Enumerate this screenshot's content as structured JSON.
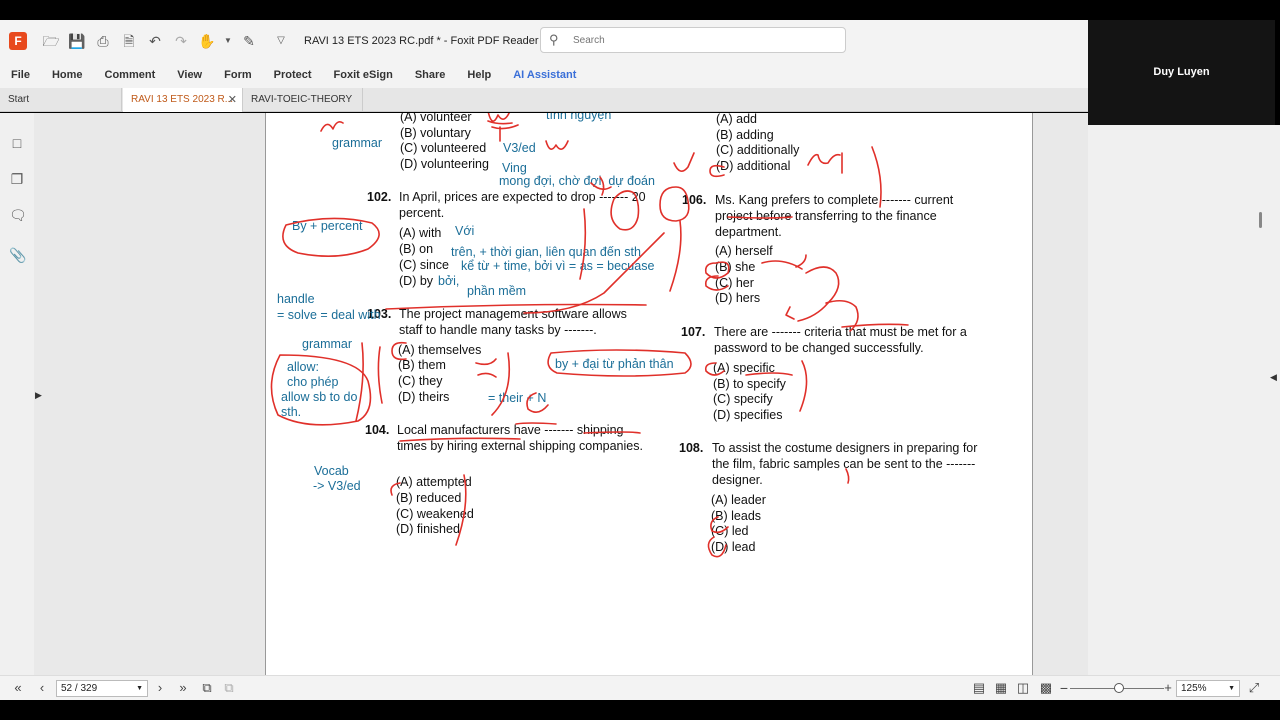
{
  "window": {
    "title": "RAVI 13 ETS 2023 RC.pdf * - Foxit PDF Reader",
    "search_placeholder": "Search"
  },
  "menu": [
    "File",
    "Home",
    "Comment",
    "View",
    "Form",
    "Protect",
    "Foxit eSign",
    "Share",
    "Help",
    "AI Assistant"
  ],
  "tabs": [
    {
      "label": "Start"
    },
    {
      "label": "RAVI 13 ETS 2023 R..."
    },
    {
      "label": "RAVI-TOEIC-THEORY"
    }
  ],
  "camera": {
    "name": "Duy Luyen"
  },
  "page": {
    "q101_options": [
      "(A)  volunteer",
      "(B)  voluntary",
      "(C)  volunteered",
      "(D)  volunteering"
    ],
    "q102": {
      "num": "102.",
      "text": "In April, prices are expected to drop ------- 20 percent.",
      "options": [
        "(A)  with",
        "(B)  on",
        "(C)  since",
        "(D)  by"
      ]
    },
    "q103": {
      "num": "103.",
      "text": "The project management software allows staff to handle many tasks by -------.",
      "options": [
        "(A)  themselves",
        "(B)  them",
        "(C)  they",
        "(D)  theirs"
      ]
    },
    "q104": {
      "num": "104.",
      "text": "Local manufacturers have ------- shipping times by hiring external shipping companies.",
      "options": [
        "(A)  attempted",
        "(B)  reduced",
        "(C)  weakened",
        "(D)  finished"
      ]
    },
    "q105_options": [
      "(A)  add",
      "(B)  adding",
      "(C)  additionally",
      "(D)  additional"
    ],
    "q106": {
      "num": "106.",
      "text": "Ms. Kang prefers to complete ------- current project before transferring to the finance department.",
      "options": [
        "(A)  herself",
        "(B)  she",
        "(C)  her",
        "(D)  hers"
      ]
    },
    "q107": {
      "num": "107.",
      "text": "There are ------- criteria that must be met for a password to be changed successfully.",
      "options": [
        "(A)  specific",
        "(B)  to specify",
        "(C)  specify",
        "(D)  specifies"
      ]
    },
    "q108": {
      "num": "108.",
      "text": "To assist the costume designers in preparing for the film, fabric samples can be sent to the ------- designer.",
      "options": [
        "(A)  leader",
        "(B)  leads",
        "(C)  led",
        "(D)  lead"
      ]
    }
  },
  "notes": {
    "tinh_nguyen": "tình nguyện",
    "grammar1": "grammar",
    "v3ed": "V3/ed",
    "ving": "Ving",
    "mong_doi": "mong đợi, chờ đợi, dự đoán",
    "by_percent": "By + percent",
    "voi": "Với",
    "tren": "trên, + thời gian, liên quan đến sth",
    "ke_tu": "kể từ + time, bởi vì = as = becuase",
    "boi": "bởi,",
    "phan_mem": "phần mềm",
    "handle": "handle",
    "solve": "= solve = deal with",
    "grammar2": "grammar",
    "allow1": "allow:",
    "allow2": "cho phép",
    "allow3": "allow sb to do",
    "allow4": "sth.",
    "by_dai_tu": "by + đại từ phản thân",
    "their_n": "= their + N",
    "vocab": "Vocab",
    "vocab_v3": "-> V3/ed"
  },
  "status": {
    "page": "52 / 329",
    "zoom": "125%"
  }
}
